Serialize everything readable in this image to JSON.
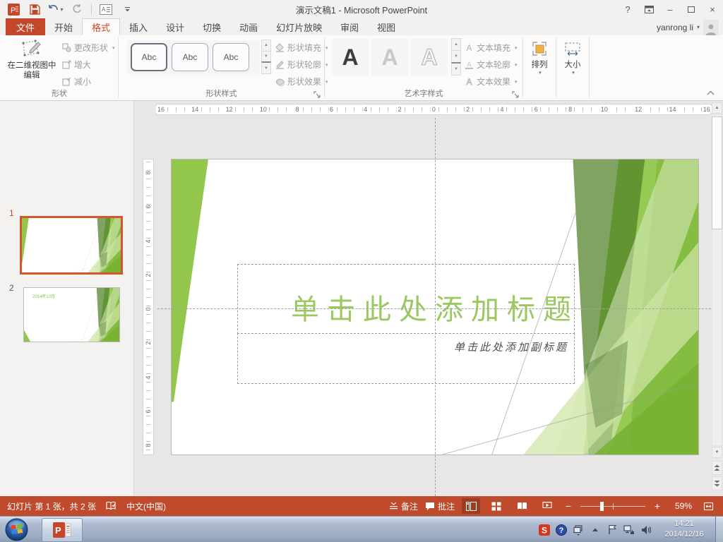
{
  "window": {
    "title": "演示文稿1 - Microsoft PowerPoint",
    "user": "yanrong li"
  },
  "icons": {
    "caret_down": "▾",
    "arrow_up": "▲",
    "arrow_down": "▼",
    "help": "?",
    "minimize": "–",
    "close": "×"
  },
  "tabs": {
    "file": "文件",
    "home": "开始",
    "format": "格式",
    "insert": "插入",
    "design": "设计",
    "transitions": "切换",
    "animations": "动画",
    "slideshow": "幻灯片放映",
    "review": "审阅",
    "view": "视图"
  },
  "ribbon": {
    "shape": {
      "group_label": "形状",
      "edit_2d": "在二维视图中编辑",
      "change_shape": "更改形状",
      "enlarge": "增大",
      "shrink": "减小"
    },
    "shape_styles": {
      "group_label": "形状样式",
      "gallery_item": "Abc",
      "fill": "形状填充",
      "outline": "形状轮廓",
      "effects": "形状效果"
    },
    "wordart": {
      "group_label": "艺术字样式",
      "gallery_item": "A",
      "fill": "文本填充",
      "outline": "文本轮廓",
      "effects": "文本效果"
    },
    "arrange_label": "排列",
    "size_label": "大小"
  },
  "panel": {
    "slide1_number": "1",
    "slide2_number": "2",
    "slide2_date": "2014年12月"
  },
  "slide": {
    "title_placeholder": "单击此处添加标题",
    "subtitle_placeholder": "单击此处添加副标题"
  },
  "rulers": {
    "horizontal": [
      "16",
      "14",
      "12",
      "10",
      "8",
      "6",
      "4",
      "2",
      "0",
      "2",
      "4",
      "6",
      "8",
      "10",
      "12",
      "14",
      "16"
    ],
    "vertical": [
      "8",
      "6",
      "4",
      "2",
      "0",
      "2",
      "4",
      "6",
      "8"
    ]
  },
  "statusbar": {
    "slide_info": "幻灯片 第 1 张，共 2 张",
    "language": "中文(中国)",
    "notes_label": "备注",
    "comments_label": "批注",
    "zoom_out": "−",
    "zoom_in": "+",
    "zoom_level": "59%"
  },
  "taskbar": {
    "time": "14:21",
    "date": "2014/12/16"
  },
  "theme": {
    "ribbon_red": "#C5472B",
    "status_red": "#C04A2C",
    "slide_green": "#8CC441",
    "title_text_green": "#9CC861",
    "selection_orange": "#D4562E"
  }
}
